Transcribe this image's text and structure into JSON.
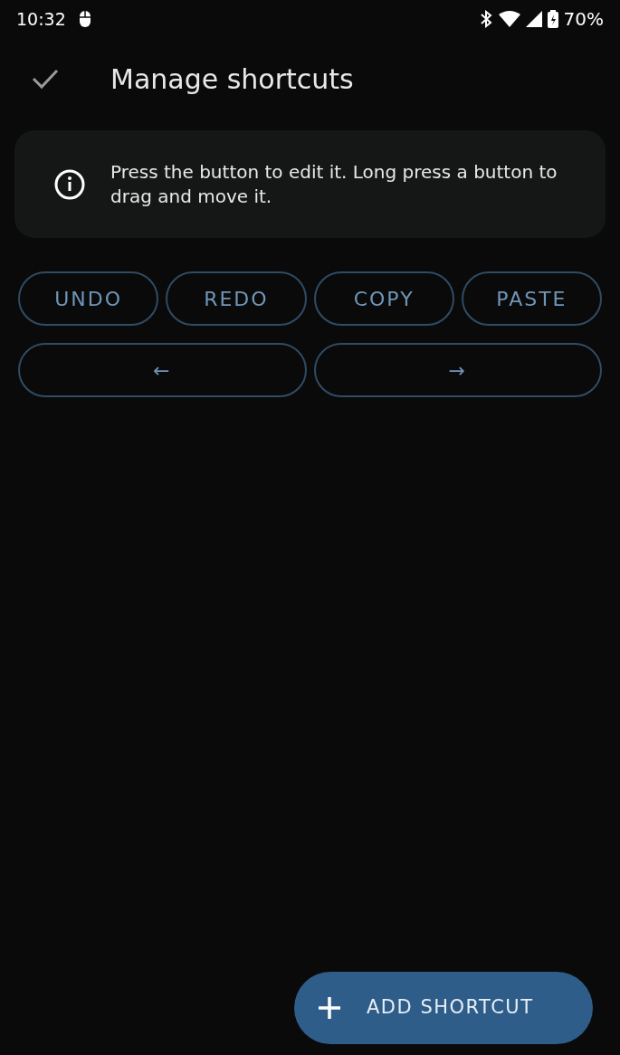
{
  "status_bar": {
    "time": "10:32",
    "battery": "70%"
  },
  "app_bar": {
    "title": "Manage shortcuts"
  },
  "info": {
    "text": "Press the button to edit it. Long press a button to drag and move it."
  },
  "shortcut_rows": [
    [
      {
        "label": "UNDO"
      },
      {
        "label": "REDO"
      },
      {
        "label": "COPY"
      },
      {
        "label": "PASTE"
      }
    ],
    [
      {
        "label": "←"
      },
      {
        "label": "→"
      }
    ]
  ],
  "fab": {
    "label": "ADD SHORTCUT"
  }
}
